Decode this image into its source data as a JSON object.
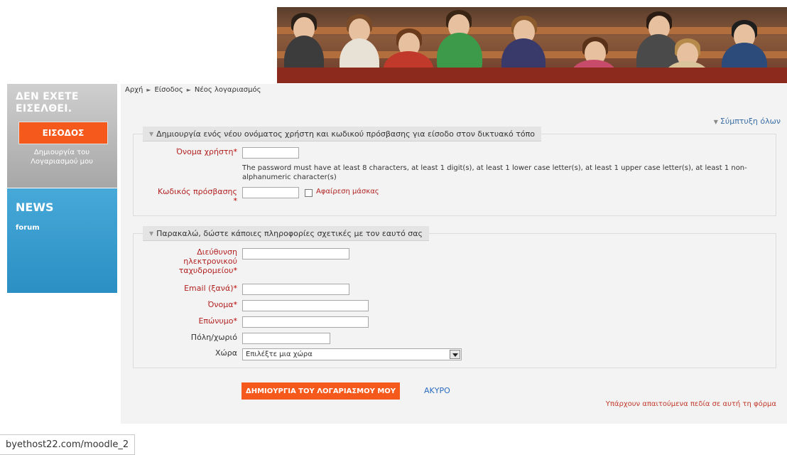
{
  "banner": {
    "image_alt": "students in lecture hall"
  },
  "sidebar": {
    "login_title": "ΔΕΝ ΕΧΕΤΕ ΕΙΣΕΛΘΕΙ.",
    "login_button": "ΕΙΣΟΔΟΣ",
    "create_account": "Δημιουργία του Λογαριασμού μου",
    "news_title": "NEWS",
    "news_link": "forum"
  },
  "breadcrumb": [
    "Αρχή",
    "Είσοδος",
    "Νέος λογαριασμός"
  ],
  "collapse_all": "Σύμπτυξη όλων",
  "section1": {
    "legend": "Δημιουργία ενός νέου ονόματος χρήστη και κωδικού πρόσβασης για είσοδο στον δικτυακό τόπο",
    "username_label": "Όνομα χρήστη",
    "password_hint": "The password must have at least 8 characters, at least 1 digit(s), at least 1 lower case letter(s), at least 1 upper case letter(s), at least 1 non-alphanumeric character(s)",
    "password_label": "Κωδικός πρόσβασης",
    "unmask_label": "Αφαίρεση μάσκας"
  },
  "section2": {
    "legend": "Παρακαλώ, δώστε κάποιες πληροφορίες σχετικές με τον εαυτό σας",
    "email_label": "Διεύθυνση ηλεκτρονικού ταχυδρομείου",
    "email_again_label": "Email (ξανά)",
    "firstname_label": "Όνομα",
    "lastname_label": "Επώνυμο",
    "city_label": "Πόλη/χωριό",
    "country_label": "Χώρα",
    "country_selected": "Επιλέξτε μια χώρα"
  },
  "required_mark": "*",
  "buttons": {
    "submit": "ΔΗΜΙΟΥΡΓΙΑ ΤΟΥ ΛΟΓΑΡΙΑΣΜΟΥ ΜΟΥ",
    "cancel": "ΑΚΥΡΟ"
  },
  "required_note": "Υπάρχουν απαιτούμενα πεδία σε αυτή τη φόρμα",
  "status_bar": {
    "url": "byethost22.com/moodle_2"
  },
  "colors": {
    "accent_orange": "#f55a1c",
    "news_blue": "#2b8fc4",
    "required_red": "#c00000",
    "link_blue": "#2a6bbf"
  }
}
